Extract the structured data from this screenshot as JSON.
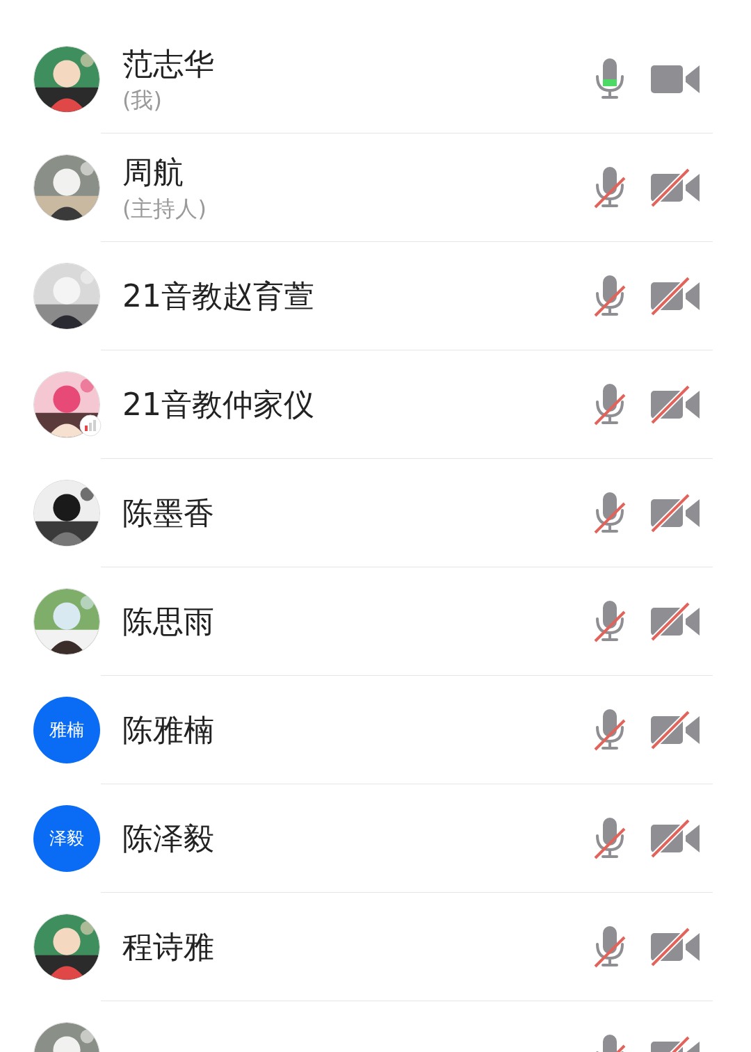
{
  "participants": [
    {
      "name": "范志华",
      "note": "(我)",
      "muted": false,
      "speaking": true,
      "camera_on": true
    },
    {
      "name": "周航",
      "note": "(主持人)",
      "muted": true,
      "camera_on": false
    },
    {
      "name": "21音教赵育萱",
      "muted": true,
      "camera_on": false
    },
    {
      "name": "21音教仲家仪",
      "weak_signal": true,
      "muted": true,
      "camera_on": false
    },
    {
      "name": "陈墨香",
      "muted": true,
      "camera_on": false
    },
    {
      "name": "陈思雨",
      "muted": true,
      "camera_on": false
    },
    {
      "name": "陈雅楠",
      "avatar": {
        "kind": "initials",
        "text": "雅楠"
      },
      "muted": true,
      "camera_on": false
    },
    {
      "name": "陈泽毅",
      "avatar": {
        "kind": "initials",
        "text": "泽毅"
      },
      "muted": true,
      "camera_on": false
    },
    {
      "name": "程诗雅",
      "muted": true,
      "camera_on": false
    },
    {
      "muted": true,
      "camera_on": false
    }
  ]
}
